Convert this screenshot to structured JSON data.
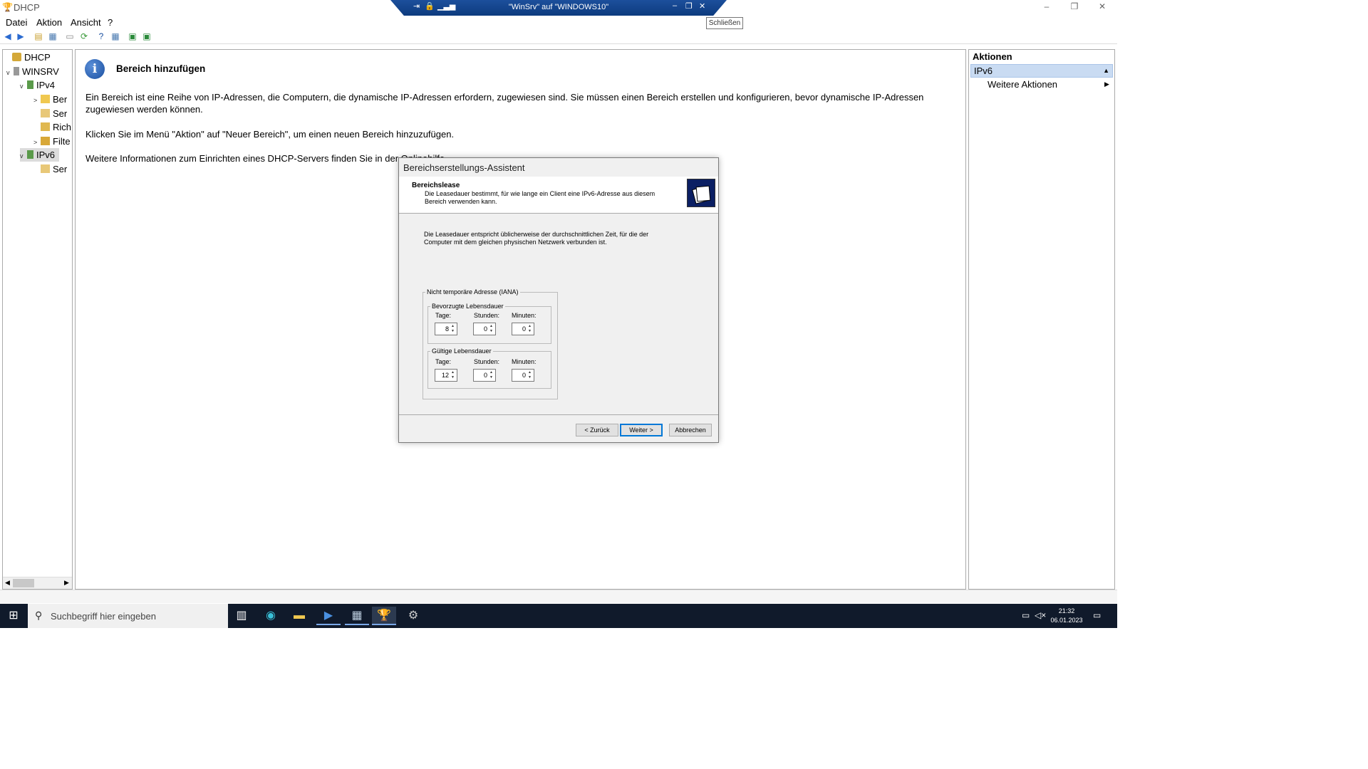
{
  "window": {
    "title": "DHCP",
    "min": "–",
    "restore": "❐",
    "close": "✕"
  },
  "rdp": {
    "title": "\"WinSrv\" auf \"WINDOWS10\"",
    "tooltip": "Schließen"
  },
  "menu": {
    "items": [
      "Datei",
      "Aktion",
      "Ansicht",
      "?"
    ]
  },
  "tree": {
    "items": [
      {
        "label": "DHCP",
        "expander": ""
      },
      {
        "label": "WINSRV",
        "expander": "v"
      },
      {
        "label": "IPv4",
        "expander": "v"
      },
      {
        "label": "Ber",
        "expander": ">"
      },
      {
        "label": "Ser",
        "expander": ""
      },
      {
        "label": "Rich",
        "expander": ""
      },
      {
        "label": "Filte",
        "expander": ">"
      },
      {
        "label": "IPv6",
        "expander": "v"
      },
      {
        "label": "Ser",
        "expander": ""
      }
    ]
  },
  "info": {
    "icon": "i",
    "title": "Bereich hinzufügen",
    "p1": "Ein Bereich ist eine Reihe von IP-Adressen, die Computern, die dynamische IP-Adressen erfordern, zugewiesen sind. Sie müssen einen Bereich erstellen und konfigurieren, bevor dynamische IP-Adressen zugewiesen werden können.",
    "p2": "Klicken Sie im Menü \"Aktion\" auf \"Neuer Bereich\", um einen neuen Bereich hinzuzufügen.",
    "p3": "Weitere Informationen zum Einrichten eines DHCP-Servers finden Sie in der Onlinehilfe."
  },
  "actions": {
    "header": "Aktionen",
    "selected": "IPv6",
    "more": "Weitere Aktionen"
  },
  "dialog": {
    "title": "Bereichserstellungs-Assistent",
    "heading": "Bereichslease",
    "subheading": "Die Leasedauer bestimmt, für wie lange ein Client eine IPv6-Adresse aus diesem Bereich verwenden kann.",
    "body": "Die Leasedauer entspricht üblicherweise der durchschnittlichen Zeit, für die der Computer mit dem gleichen physischen Netzwerk verbunden ist.",
    "group_outer": "Nicht temporäre Adresse (IANA)",
    "preferred": {
      "legend": "Bevorzugte Lebensdauer",
      "days_label": "Tage:",
      "hours_label": "Stunden:",
      "minutes_label": "Minuten:",
      "days": "8",
      "hours": "0",
      "minutes": "0"
    },
    "valid": {
      "legend": "Gültige Lebensdauer",
      "days_label": "Tage:",
      "hours_label": "Stunden:",
      "minutes_label": "Minuten:",
      "days": "12",
      "hours": "0",
      "minutes": "0"
    },
    "back": "< Zurück",
    "next": "Weiter >",
    "cancel": "Abbrechen"
  },
  "taskbar": {
    "search_placeholder": "Suchbegriff hier eingeben",
    "time": "21:32",
    "date": "06.01.2023"
  }
}
